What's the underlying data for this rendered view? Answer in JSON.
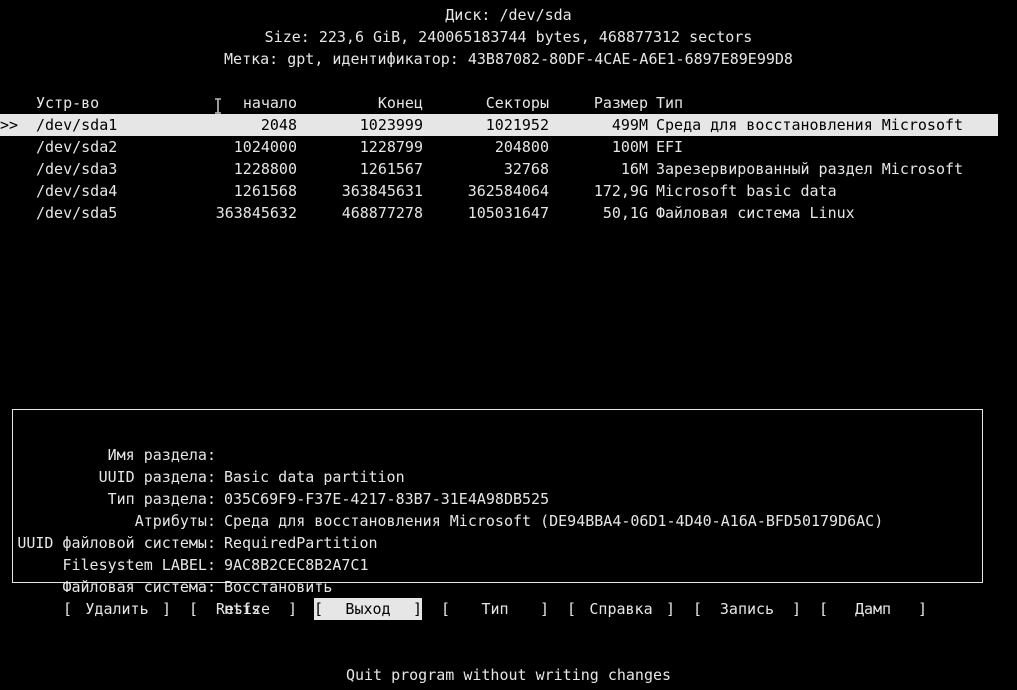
{
  "header": {
    "disk_line": "Диск: /dev/sda",
    "size_line": "Size: 223,6 GiB, 240065183744 bytes, 468877312 sectors",
    "label_line": "Метка: gpt, идентификатор: 43B87082-80DF-4CAE-A6E1-6897E89E99D8"
  },
  "table": {
    "columns": {
      "device": "Устр-во",
      "start": "начало",
      "end": "Конец",
      "sectors": "Секторы",
      "size": "Размер",
      "type": "Тип"
    },
    "selected_marker": ">>",
    "rows": [
      {
        "device": "/dev/sda1",
        "start": "2048",
        "end": "1023999",
        "sectors": "1021952",
        "size": "499M",
        "type": "Среда для восстановления Microsoft"
      },
      {
        "device": "/dev/sda2",
        "start": "1024000",
        "end": "1228799",
        "sectors": "204800",
        "size": "100M",
        "type": "EFI"
      },
      {
        "device": "/dev/sda3",
        "start": "1228800",
        "end": "1261567",
        "sectors": "32768",
        "size": "16M",
        "type": "Зарезервированный раздел Microsoft"
      },
      {
        "device": "/dev/sda4",
        "start": "1261568",
        "end": "363845631",
        "sectors": "362584064",
        "size": "172,9G",
        "type": "Microsoft basic data"
      },
      {
        "device": "/dev/sda5",
        "start": "363845632",
        "end": "468877278",
        "sectors": "105031647",
        "size": "50,1G",
        "type": "Файловая система Linux"
      }
    ]
  },
  "info": [
    {
      "label": "Имя раздела:",
      "value": "Basic data partition"
    },
    {
      "label": "UUID раздела:",
      "value": "035C69F9-F37E-4217-83B7-31E4A98DB525"
    },
    {
      "label": "Тип раздела:",
      "value": "Среда для восстановления Microsoft (DE94BBA4-06D1-4D40-A16A-BFD50179D6AC)"
    },
    {
      "label": "Атрибуты:",
      "value": "RequiredPartition"
    },
    {
      "label": "UUID файловой системы:",
      "value": "9AC8B2CEC8B2A7C1"
    },
    {
      "label": "Filesystem LABEL:",
      "value": "Восстановить"
    },
    {
      "label": "Файловая система:",
      "value": "ntfs"
    }
  ],
  "menu": {
    "delete": "Удалить",
    "resize": "Resize",
    "quit": "Выход",
    "type": "Тип",
    "help": "Справка",
    "write": "Запись",
    "dump": "Дамп"
  },
  "status": {
    "hint": "Quit program without writing changes"
  }
}
